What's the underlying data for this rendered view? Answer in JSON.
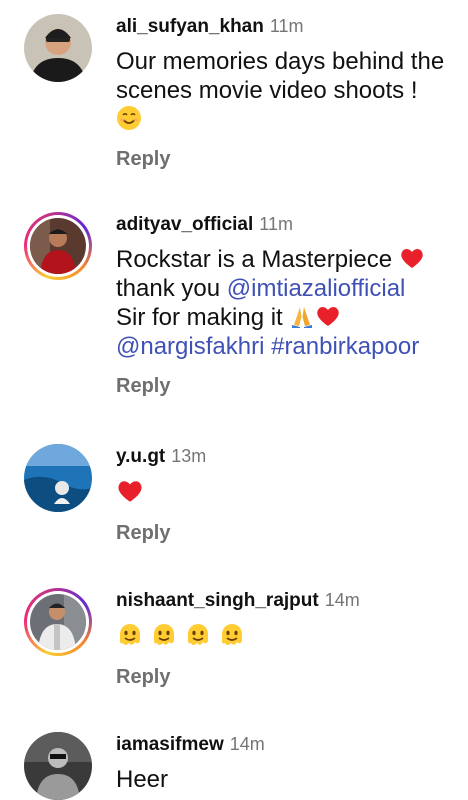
{
  "comments": [
    {
      "username": "ali_sufyan_khan",
      "time": "11m",
      "text": "Our memories days behind the scenes movie video shoots !",
      "emoji": "smiling-face-emoji",
      "reply": "Reply"
    },
    {
      "username": "adityav_official",
      "time": "11m",
      "text_part1": "Rockstar is a Masterpiece",
      "text_part2": "thank you",
      "mention1": "@imtiazaliofficial",
      "text_part3": "Sir for making it",
      "mention2": "@nargisfakhri",
      "hashtag": "#ranbirkapoor",
      "reply": "Reply"
    },
    {
      "username": "y.u.gt",
      "time": "13m",
      "emoji": "red-heart-emoji",
      "reply": "Reply"
    },
    {
      "username": "nishaant_singh_rajput",
      "time": "14m",
      "emoji": "melting-face-emoji",
      "emoji_count": 4,
      "reply": "Reply"
    },
    {
      "username": "iamasifmew",
      "time": "14m",
      "text": "Heer"
    }
  ],
  "colors": {
    "mention": "#3f51b5",
    "timestamp": "#757575",
    "reply": "#6f6f6f",
    "heart": "#e8202a"
  }
}
